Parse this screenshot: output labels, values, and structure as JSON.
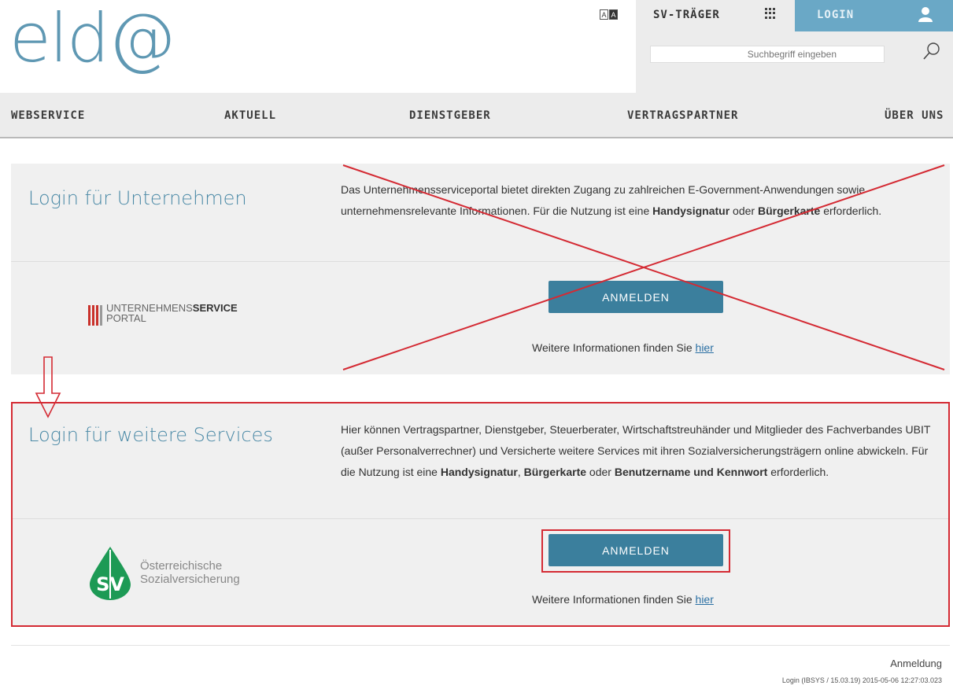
{
  "logo": "eld@",
  "header": {
    "font_toggle": [
      "A",
      "A"
    ],
    "sv_traeger": "SV-TRÄGER",
    "login": "LOGIN",
    "search_placeholder": "Suchbegriff eingeben"
  },
  "nav": [
    "WEBSERVICE",
    "AKTUELL",
    "DIENSTGEBER",
    "VERTRAGSPARTNER",
    "ÜBER UNS"
  ],
  "card1": {
    "title": "Login für Unternehmen",
    "text_1": "Das Unternehmensserviceportal bietet direkten Zugang zu zahlreichen E-Government-Anwendungen sowie unternehmensrelevante Informationen. Für die Nutzung ist eine ",
    "bold_1": "Handysignatur",
    "text_2": " oder ",
    "bold_2": "Bürgerkarte",
    "text_3": " erforderlich.",
    "logo_line1_a": "UNTERNEHMENS",
    "logo_line1_b": "SERVICE",
    "logo_line2": "PORTAL",
    "button": "ANMELDEN",
    "more_text": "Weitere Informationen finden Sie ",
    "more_link": "hier"
  },
  "card2": {
    "title": "Login für weitere Services",
    "text_1": "Hier können Vertragspartner, Dienstgeber, Steuerberater, Wirtschaftstreuhänder und Mitglieder des Fachverbandes UBIT (außer Personalverrechner) und Versicherte weitere Services mit ihren Sozialversicherungsträgern online abwickeln. Für die Nutzung ist eine ",
    "bold_1": "Handysignatur",
    "text_2": ", ",
    "bold_2": "Bürgerkarte",
    "text_3": " oder ",
    "bold_3": "Benutzername und Kennwort",
    "text_4": " erforderlich.",
    "logo_mark": "SV",
    "logo_line1": "Österreichische",
    "logo_line2": "Sozialversicherung",
    "button": "ANMELDEN",
    "more_text": "Weitere Informationen finden Sie ",
    "more_link": "hier"
  },
  "footer": {
    "label": "Anmeldung",
    "build": "Login (IBSYS / 15.03.19) 2015-05-06 12:27:03.023"
  },
  "annotation_color": "#d42a33"
}
